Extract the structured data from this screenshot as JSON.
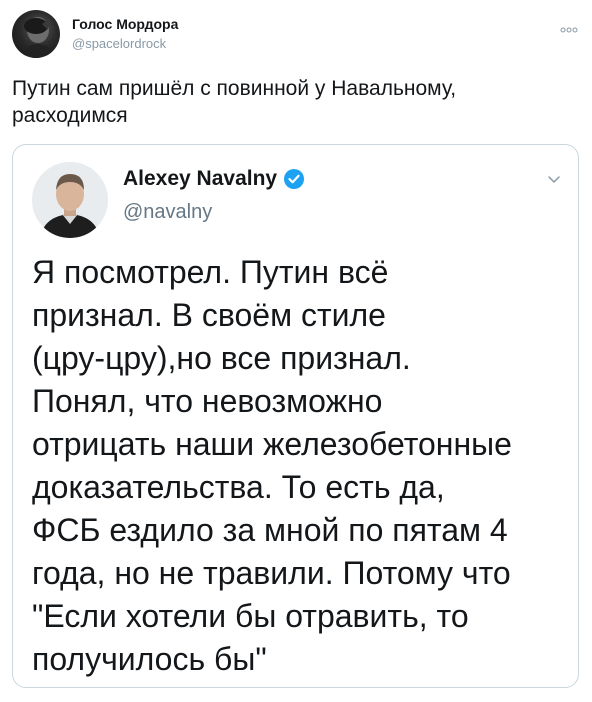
{
  "outer_tweet": {
    "author_name": "Голос Мордора",
    "author_handle": "@spacelordrock",
    "text": "Путин сам пришёл с повинной у Навальному, расходимся"
  },
  "quoted_tweet": {
    "author_name": "Alexey Navalny",
    "author_handle": "@navalny",
    "verified": true,
    "text": "Я посмотрел. Путин всё\nпризнал. В своём стиле\n(цру-цру),но все признал.\nПонял, что невозможно\nотрицать наши железобетонные\nдоказательства. То есть да,\nФСБ ездило за мной по пятам 4\nгода, но не травили. Потому что\n\"Если хотели бы отравить, то\nполучилось бы\""
  },
  "colors": {
    "verified_blue": "#1da1f2",
    "handle_gray": "#8899a6",
    "border": "#ccd6dd"
  },
  "icons": {
    "more": "more-icon",
    "verified": "verified-badge-icon",
    "chevron": "chevron-down-icon"
  }
}
